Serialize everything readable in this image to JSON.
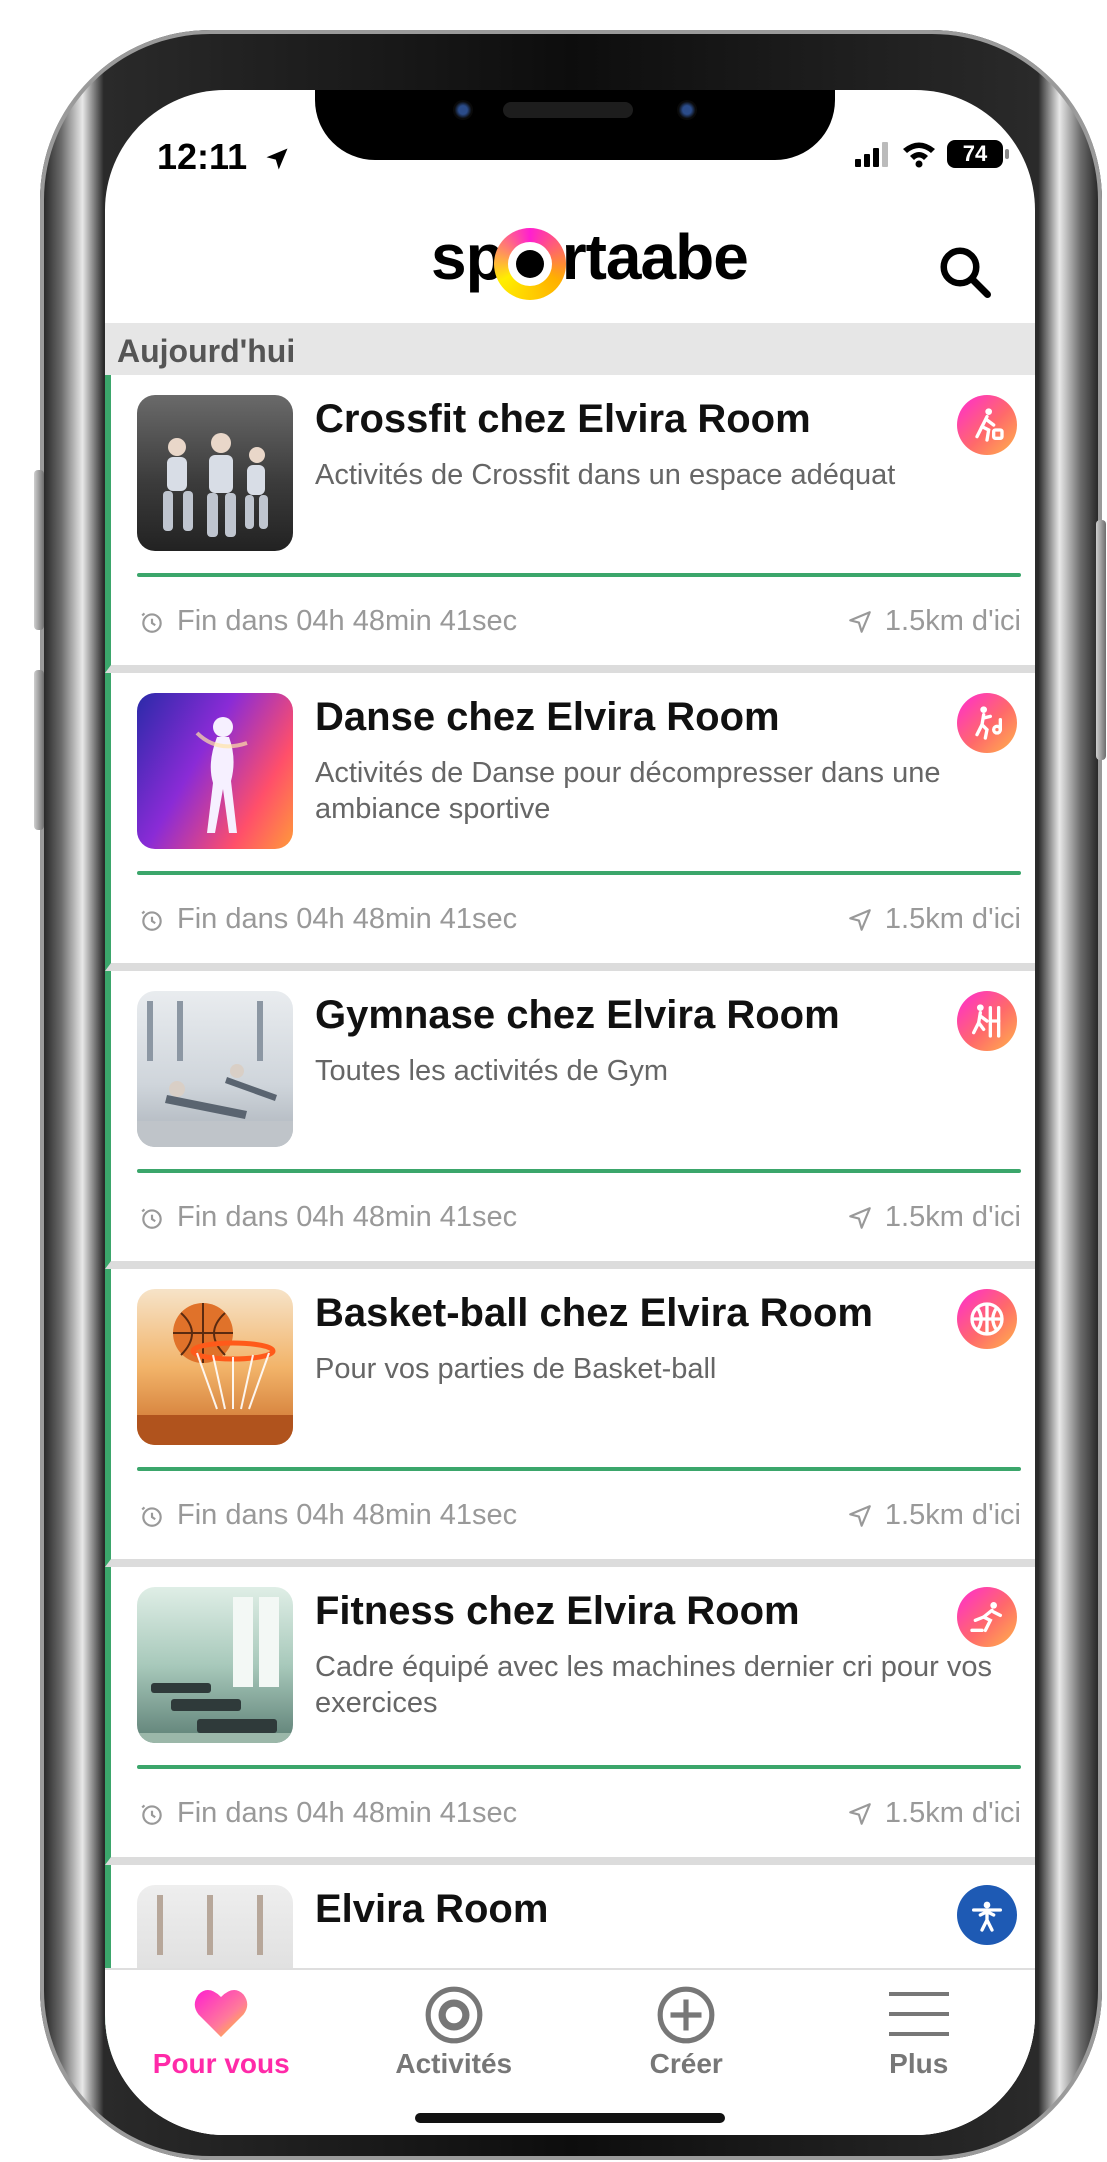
{
  "status_bar": {
    "time": "12:11",
    "battery": "74"
  },
  "header": {
    "logo_prefix": "sp",
    "logo_suffix": "rtaabe"
  },
  "section": {
    "title": "Aujourd'hui"
  },
  "cards": [
    {
      "title": "Crossfit chez Elvira Room",
      "description": "Activités de Crossfit dans un espace adéquat",
      "time_left": "Fin dans 04h 48min 41sec",
      "distance": "1.5km d'ici",
      "icon": "crossfit-icon"
    },
    {
      "title": "Danse chez Elvira Room",
      "description": "Activités de Danse pour décompresser dans une ambiance sportive",
      "time_left": "Fin dans 04h 48min 41sec",
      "distance": "1.5km d'ici",
      "icon": "dance-icon"
    },
    {
      "title": "Gymnase chez Elvira Room",
      "description": "Toutes les activités de Gym",
      "time_left": "Fin dans 04h 48min 41sec",
      "distance": "1.5km d'ici",
      "icon": "gym-icon"
    },
    {
      "title": "Basket-ball chez Elvira Room",
      "description": "Pour vos parties de Basket-ball",
      "time_left": "Fin dans 04h 48min 41sec",
      "distance": "1.5km d'ici",
      "icon": "basketball-icon"
    },
    {
      "title": "Fitness chez Elvira Room",
      "description": "Cadre équipé avec les machines dernier cri pour vos exercices",
      "time_left": "Fin dans 04h 48min 41sec",
      "distance": "1.5km d'ici",
      "icon": "fitness-icon"
    },
    {
      "title": "Elvira Room",
      "icon": "weightlifting-icon"
    }
  ],
  "tabs": [
    {
      "label": "Pour vous",
      "icon": "heart-icon",
      "active": true
    },
    {
      "label": "Activités",
      "icon": "target-icon",
      "active": false
    },
    {
      "label": "Créer",
      "icon": "plus-circle-icon",
      "active": false
    },
    {
      "label": "Plus",
      "icon": "menu-icon",
      "active": false
    }
  ],
  "colors": {
    "accent_green": "#3ba66b",
    "accent_pink": "#ff2aa8",
    "section_bg": "#e6e6e6"
  }
}
